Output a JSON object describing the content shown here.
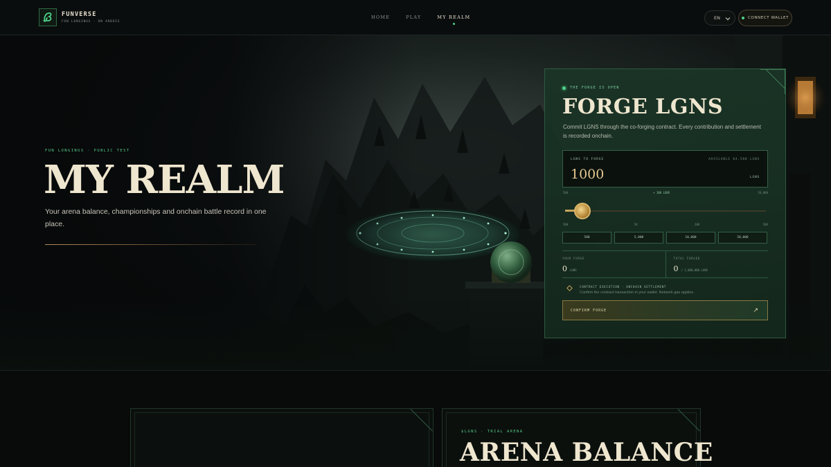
{
  "nav": {
    "brand": "FUNVERSE",
    "brand_sub": "FUN LONGINUS · ON ARBOIS",
    "items": [
      {
        "label": "HOME",
        "active": false
      },
      {
        "label": "PLAY",
        "active": false
      },
      {
        "label": "MY REALM",
        "active": true
      }
    ],
    "lang": "EN",
    "wallet_label": "CONNECT WALLET"
  },
  "hero": {
    "eyebrow": "FUN LONGINUS · PUBLIC TEST",
    "title": "MY REALM",
    "copy": "Your arena balance, championships and onchain battle record in one place."
  },
  "forge": {
    "status": "THE FORGE IS OPEN",
    "title": "FORGE LGNS",
    "description": "Commit LGNS through the co-forging contract. Every contribution and settlement is recorded onchain.",
    "input_label": "LGNS TO FORGE",
    "available": "AVAILABLE 84,500 LGNS",
    "amount": "1000",
    "unit": "LGNS",
    "slider": {
      "min_label": "500",
      "mid_label": "+ 100 LGNS",
      "max_label": "50,000",
      "tick_labels": [
        "500",
        "5K",
        "20K",
        "50K"
      ],
      "fraction": 0.085
    },
    "presets": [
      "500",
      "5,000",
      "10,000",
      "50,000"
    ],
    "stats": [
      {
        "label": "YOUR FORGE",
        "value": "0",
        "unit": "LGNS"
      },
      {
        "label": "TOTAL FORGED",
        "value": "0",
        "unit": "/ 1,000,000 LGNS"
      }
    ],
    "exec_title": "CONTRACT EXECUTION · ONCHAIN SETTLEMENT",
    "exec_sub": "Confirm the contract transaction in your wallet. Network gas applies.",
    "confirm_label": "CONFIRM FORGE",
    "confirm_icon": "arrow-up-right-icon"
  },
  "arena": {
    "eyebrow": "$LGNS · TRIAL ARENA",
    "title": "ARENA BALANCE"
  },
  "colors": {
    "accent_green": "#4fd38a",
    "gold": "#c8a45c",
    "panel": "#1a3426",
    "cream": "#efe6cf"
  }
}
